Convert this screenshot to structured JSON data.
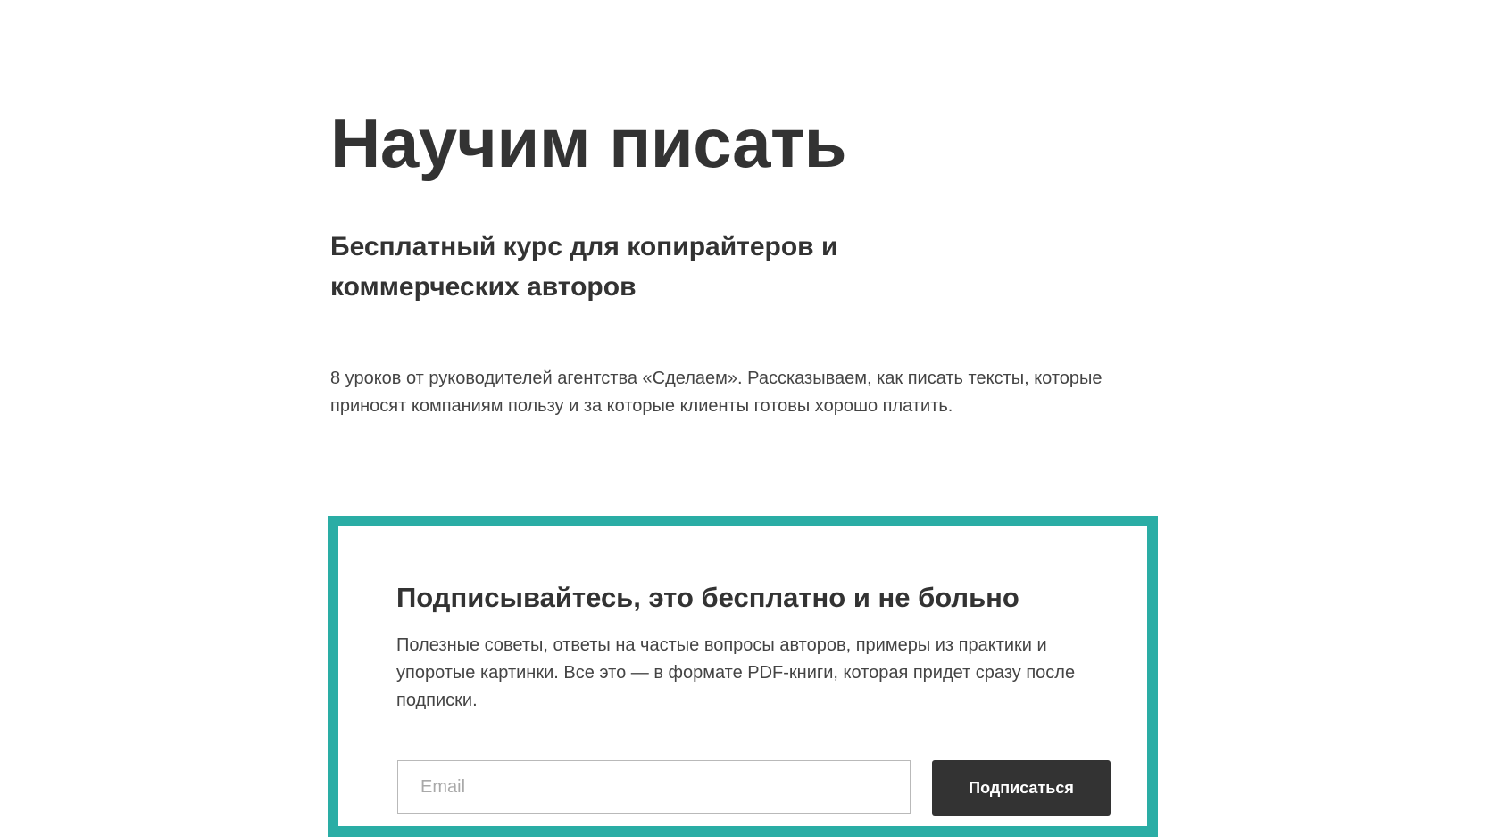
{
  "hero": {
    "title": "Научим писать",
    "subtitle": "Бесплатный курс для копирайтеров и коммерческих авторов",
    "description": "8 уроков от руководителей агентства «Сделаем». Рассказываем, как писать тексты, которые приносят компаниям пользу и за которые клиенты готовы хорошо платить."
  },
  "subscribe": {
    "title": "Подписывайтесь, это бесплатно и не больно",
    "description": "Полезные советы, ответы на частые вопросы авторов, примеры из практики и упоротые картинки. Все это — в формате PDF-книги, которая придет сразу после подписки.",
    "email_placeholder": "Email",
    "email_value": "",
    "button_label": "Подписаться",
    "border_color": "#2aada5",
    "button_color": "#333333"
  }
}
